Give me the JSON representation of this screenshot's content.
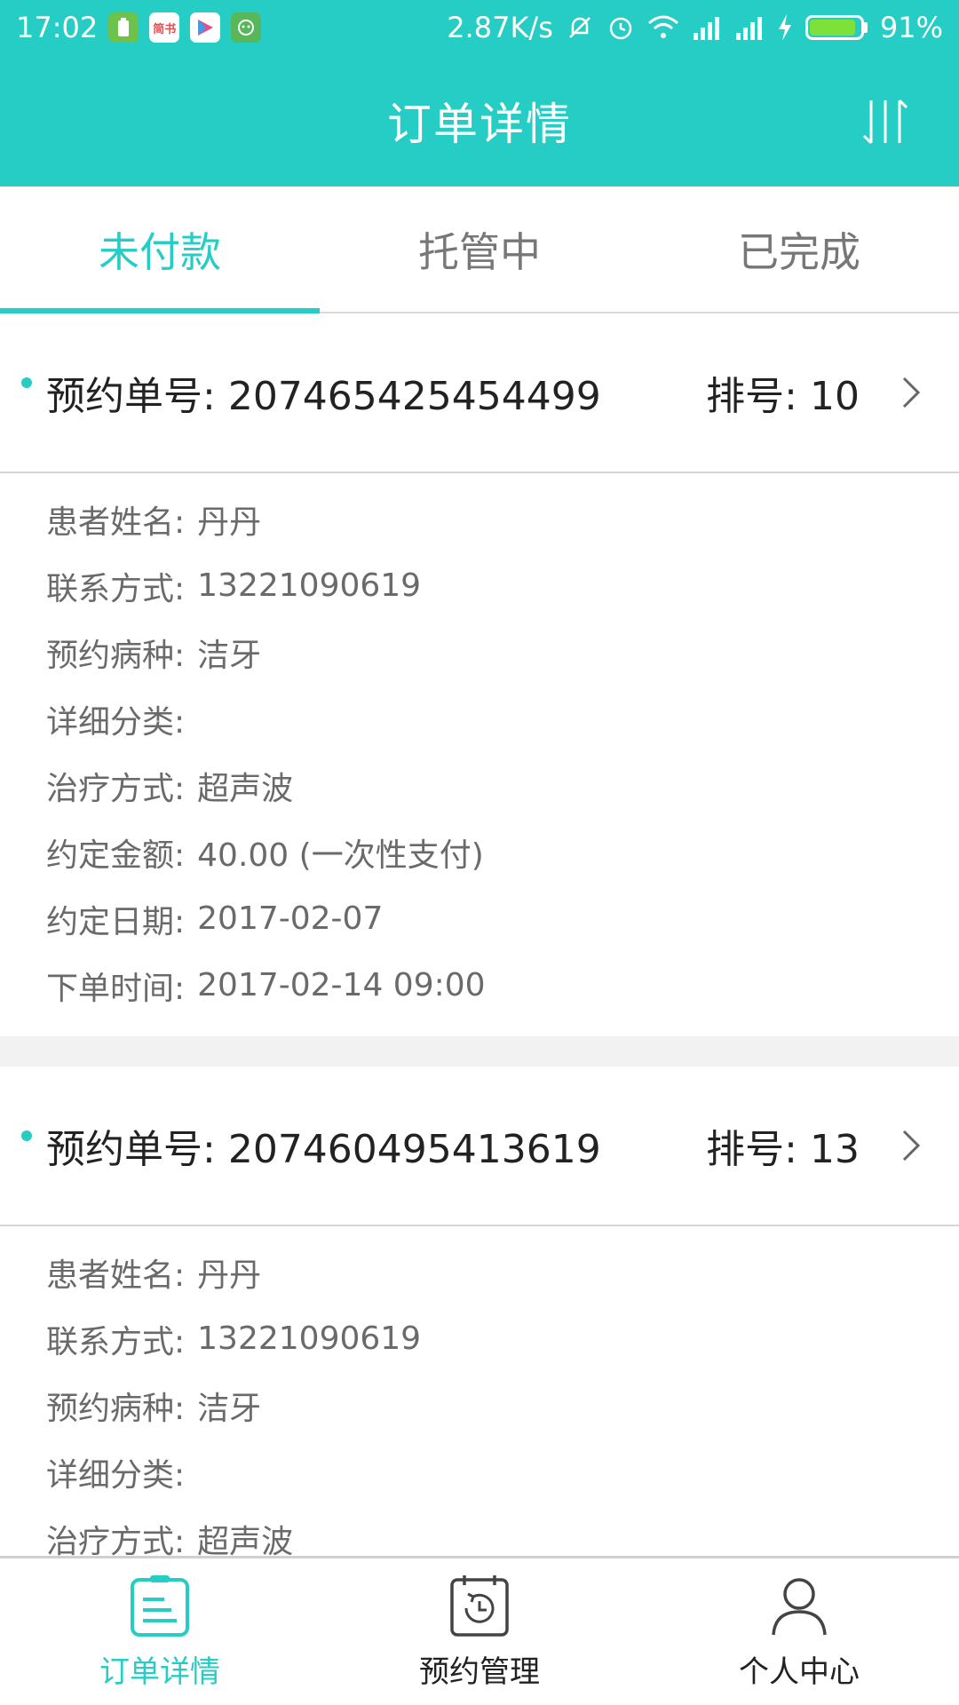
{
  "status_bar": {
    "time": "17:02",
    "app_icon_label": "简书",
    "network_speed": "2.87K/s",
    "battery_percent": "91%"
  },
  "header": {
    "title": "订单详情",
    "sort_icon": "sort-icon"
  },
  "tabs": [
    {
      "label": "未付款",
      "active": true
    },
    {
      "label": "托管中",
      "active": false
    },
    {
      "label": "已完成",
      "active": false
    }
  ],
  "labels": {
    "order_no": "预约单号:",
    "queue": "排号:",
    "patient_name": "患者姓名:",
    "contact": "联系方式:",
    "disease": "预约病种:",
    "category": "详细分类:",
    "treatment": "治疗方式:",
    "amount": "约定金额:",
    "date": "约定日期:",
    "order_time": "下单时间:"
  },
  "orders": [
    {
      "order_no": "207465425454499",
      "queue": "10",
      "patient_name": "丹丹",
      "contact": "13221090619",
      "disease": "洁牙",
      "category": "",
      "treatment": "超声波",
      "amount": "40.00 (一次性支付)",
      "date": "2017-02-07",
      "order_time": "2017-02-14 09:00"
    },
    {
      "order_no": "207460495413619",
      "queue": "13",
      "patient_name": "丹丹",
      "contact": "13221090619",
      "disease": "洁牙",
      "category": "",
      "treatment": "超声波"
    }
  ],
  "bottom_nav": [
    {
      "label": "订单详情",
      "icon": "order-list-icon",
      "active": true
    },
    {
      "label": "预约管理",
      "icon": "calendar-history-icon",
      "active": false
    },
    {
      "label": "个人中心",
      "icon": "user-icon",
      "active": false
    }
  ],
  "colors": {
    "accent": "#26cdc4",
    "text": "#222222",
    "muted": "#6a6a6a",
    "divider": "#d5d5d5"
  }
}
